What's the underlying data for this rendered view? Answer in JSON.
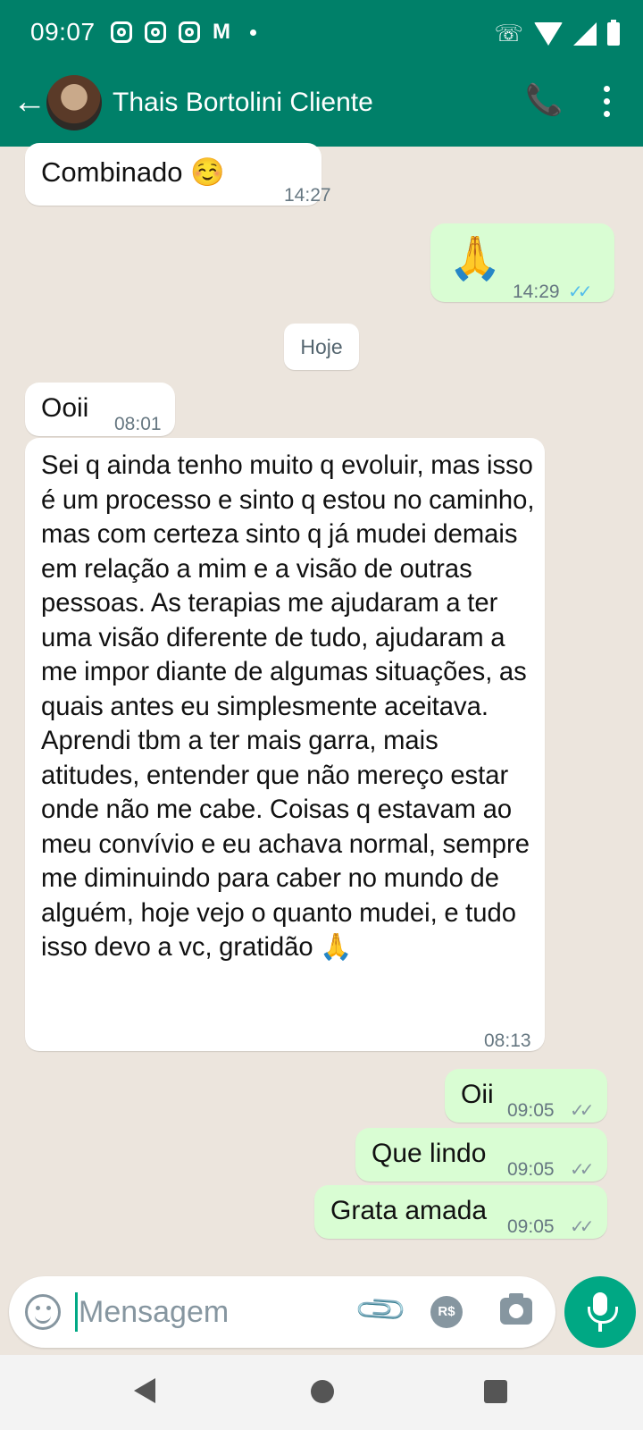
{
  "status_bar": {
    "time": "09:07",
    "gmail": "M"
  },
  "header": {
    "contact_name": "Thais Bortolini Cliente"
  },
  "date_chip": "Hoje",
  "messages": [
    {
      "dir": "in",
      "text": "Combinado ☺️",
      "time": "14:27"
    },
    {
      "dir": "out",
      "text": "🙏",
      "time": "14:29",
      "ticks": "✓✓",
      "read": true
    },
    {
      "dir": "in",
      "text": "Ooii",
      "time": "08:01"
    },
    {
      "dir": "in",
      "text": "Sei q ainda tenho muito q evoluir, mas isso é um processo e sinto q estou no caminho, mas com certeza sinto q já mudei demais em relação a mim e a visão de outras pessoas. As terapias me ajudaram a ter uma visão diferente de tudo, ajudaram a me impor diante de algumas situações, as quais antes eu simplesmente aceitava. Aprendi tbm a ter mais garra, mais atitudes, entender que não mereço estar onde não me cabe. Coisas q estavam ao meu convívio e eu achava normal, sempre me diminuindo para caber no mundo de alguém, hoje vejo o quanto mudei, e tudo isso devo a vc, gratidão 🙏",
      "time": "08:13"
    },
    {
      "dir": "out",
      "text": "Oii",
      "time": "09:05",
      "ticks": "✓✓",
      "read": false
    },
    {
      "dir": "out",
      "text": "Que lindo",
      "time": "09:05",
      "ticks": "✓✓",
      "read": false
    },
    {
      "dir": "out",
      "text": "Grata amada",
      "time": "09:05",
      "ticks": "✓✓",
      "read": false
    }
  ],
  "input": {
    "placeholder": "Mensagem",
    "currency_label": "R$"
  },
  "colors": {
    "header": "#008069",
    "outgoing": "#D9FDD3",
    "incoming": "#FFFFFF",
    "accent": "#00A884",
    "read_ticks": "#53BDEB"
  },
  "icons": [
    "instagram-icon",
    "gmail-icon",
    "back-arrow-icon",
    "add-call-icon",
    "more-vert-icon",
    "emoji-icon",
    "attach-icon",
    "payment-icon",
    "camera-icon",
    "mic-icon"
  ]
}
